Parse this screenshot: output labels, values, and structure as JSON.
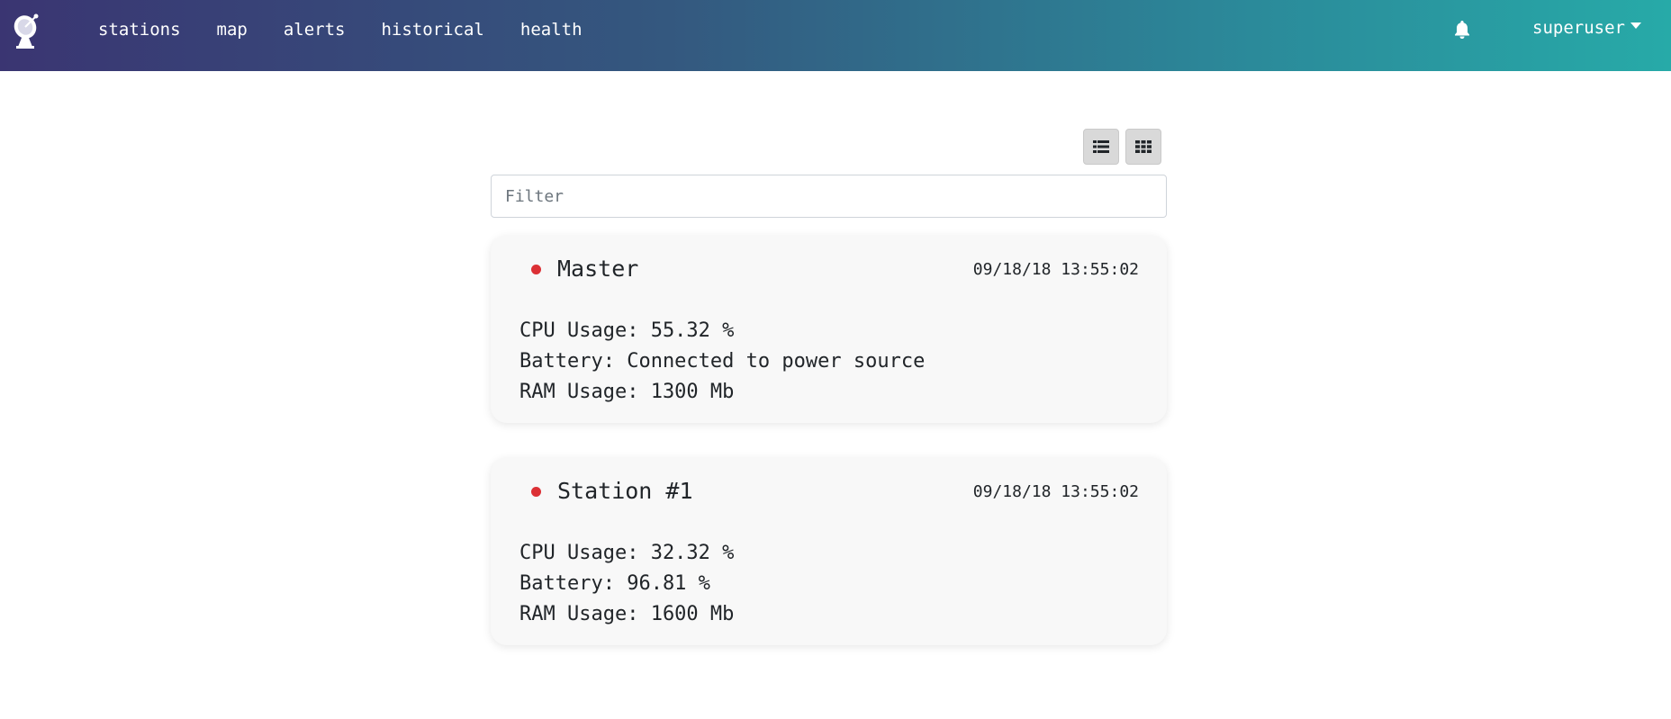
{
  "nav": {
    "logo_icon": "satellite-dish-icon",
    "links": [
      {
        "label": "stations"
      },
      {
        "label": "map"
      },
      {
        "label": "alerts"
      },
      {
        "label": "historical"
      },
      {
        "label": "health"
      }
    ],
    "notifications_icon": "bell-icon",
    "user": "superuser"
  },
  "toolbar": {
    "list_view_icon": "list-view-icon",
    "grid_view_icon": "grid-view-icon"
  },
  "filter": {
    "placeholder": "Filter",
    "value": ""
  },
  "stations": [
    {
      "name": "Master",
      "timestamp": "09/18/18 13:55:02",
      "status_color": "#dc3035",
      "cpu": "CPU Usage: 55.32 %",
      "battery": "Battery: Connected to power source",
      "ram": "RAM Usage: 1300 Mb"
    },
    {
      "name": "Station #1",
      "timestamp": "09/18/18 13:55:02",
      "status_color": "#dc3035",
      "cpu": "CPU Usage: 32.32 %",
      "battery": "Battery: 96.81 %",
      "ram": "RAM Usage: 1600 Mb"
    }
  ],
  "colors": {
    "navbar_gradient_start": "#3a3572",
    "navbar_gradient_end": "#27aaa8",
    "status_offline": "#dc3035"
  }
}
